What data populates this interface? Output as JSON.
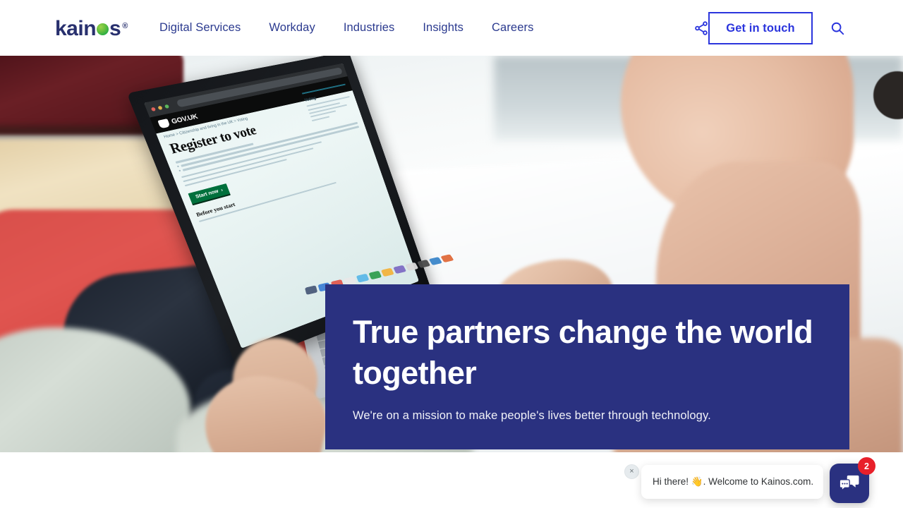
{
  "site": {
    "brand_name": "kainos",
    "brand_mark": "registered-trademark",
    "registered_symbol": "®"
  },
  "header": {
    "nav_items": [
      {
        "label": "Digital Services"
      },
      {
        "label": "Workday"
      },
      {
        "label": "Industries"
      },
      {
        "label": "Insights"
      },
      {
        "label": "Careers"
      }
    ],
    "share_icon": "share-icon",
    "search_icon": "search-icon",
    "cta_label": "Get in touch",
    "accent_blue": "#2b35dd",
    "navy": "#2a3180",
    "brand_green": "#00a14b"
  },
  "hero": {
    "heading": "True partners change the world together",
    "subheading": "We're on a mission to make people's lives better through technology.",
    "panel_color": "#2a3180",
    "image_alt": "Older person using a laptop on a sofa",
    "laptop_screen": {
      "browser_dots": [
        "red",
        "yellow",
        "green"
      ],
      "site_name": "GOV.UK",
      "breadcrumb": "Home  >  Citizenship and living in the UK  >  Voting",
      "page_title": "Register to vote",
      "start_button": "Start now",
      "start_button_arrow": "›",
      "section_heading": "Before you start",
      "sidebar_title": "Voting"
    }
  },
  "chat": {
    "message": "Hi there! 👋. Welcome to Kainos.com.",
    "close_label": "×",
    "badge_count": "2",
    "fab_icon": "chat-bubbles-icon",
    "badge_color": "#e8202a"
  }
}
